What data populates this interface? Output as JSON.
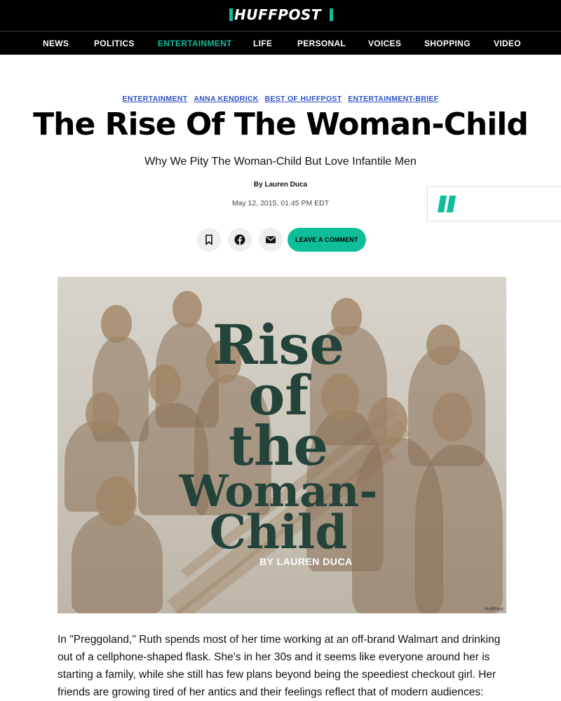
{
  "brand": {
    "logo_text": "HUFFPOST",
    "accent_color": "#0dbe98"
  },
  "nav": {
    "items": [
      {
        "label": "NEWS"
      },
      {
        "label": "POLITICS"
      },
      {
        "label": "ENTERTAINMENT",
        "active": true
      },
      {
        "label": "LIFE"
      },
      {
        "label": "PERSONAL"
      },
      {
        "label": "VOICES"
      },
      {
        "label": "SHOPPING"
      },
      {
        "label": "VIDEO"
      }
    ]
  },
  "article": {
    "tags": [
      "ENTERTAINMENT",
      "ANNA KENDRICK",
      "BEST OF HUFFPOST",
      "ENTERTAINMENT-BRIEF"
    ],
    "headline": "The Rise Of The Woman-Child",
    "subheadline": "Why We Pity The Woman-Child But Love Infantile Men",
    "byline": "By Lauren Duca",
    "date": "May 12, 2015, 01:45 PM EDT",
    "actions": {
      "bookmark_icon": "bookmark-icon",
      "facebook_icon": "facebook-icon",
      "email_icon": "email-icon",
      "comment_label": "LEAVE A COMMENT"
    },
    "hero": {
      "title_lines": [
        "Rise",
        "of",
        "the",
        "Woman-",
        "Child"
      ],
      "byline": "BY LAUREN DUCA",
      "credit": "HuffPost"
    },
    "body": "In \"Preggoland,\" Ruth spends most of her time working at an off-brand Walmart and drinking out of a cellphone-shaped flask. She's in her 30s and it seems like everyone around her is starting a family, while she still has few plans beyond being the speediest checkout girl. Her friends are growing tired of her antics and their feelings reflect that of modern audiences:"
  }
}
